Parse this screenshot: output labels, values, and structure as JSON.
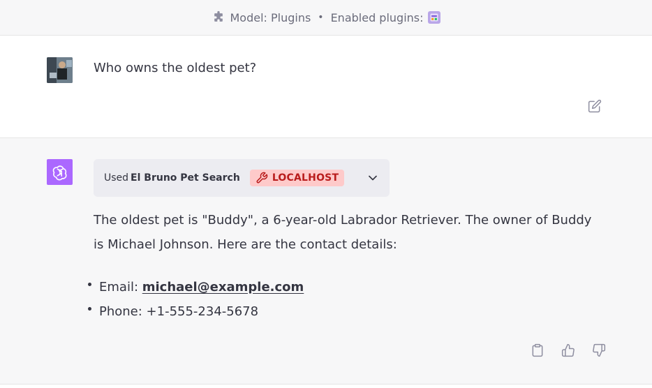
{
  "topbar": {
    "model_label": "Model: Plugins",
    "separator": "•",
    "enabled_label": "Enabled plugins:",
    "icons": {
      "model": "puzzle-icon",
      "plugin": "plugin-thumbnail-icon"
    }
  },
  "user_message": {
    "avatar": "user-avatar-photo",
    "text": "Who owns the oldest pet?",
    "edit_icon": "edit-icon"
  },
  "assistant_message": {
    "avatar_icon": "openai-logo-icon",
    "plugin_used": {
      "prefix": "Used",
      "name": "El Bruno Pet Search",
      "badge": "LOCALHOST",
      "badge_icon": "wrench-icon",
      "expand_icon": "chevron-down-icon"
    },
    "paragraph": "The oldest pet is \"Buddy\", a 6-year-old Labrador Retriever. The owner of Buddy is Michael Johnson. Here are the contact details:",
    "contacts": [
      {
        "label": "Email: ",
        "value": "michael@example.com"
      },
      {
        "label": "Phone: ",
        "value": "+1-555-234-5678"
      }
    ],
    "actions": [
      "clipboard-icon",
      "thumbs-up-icon",
      "thumbs-down-icon"
    ]
  },
  "colors": {
    "avatar_purple": "#ab68ff",
    "badge_bg": "#fecaca",
    "badge_text": "#b91c1c",
    "pill_bg": "#ececf1",
    "row_bg": "#f7f7f8"
  }
}
